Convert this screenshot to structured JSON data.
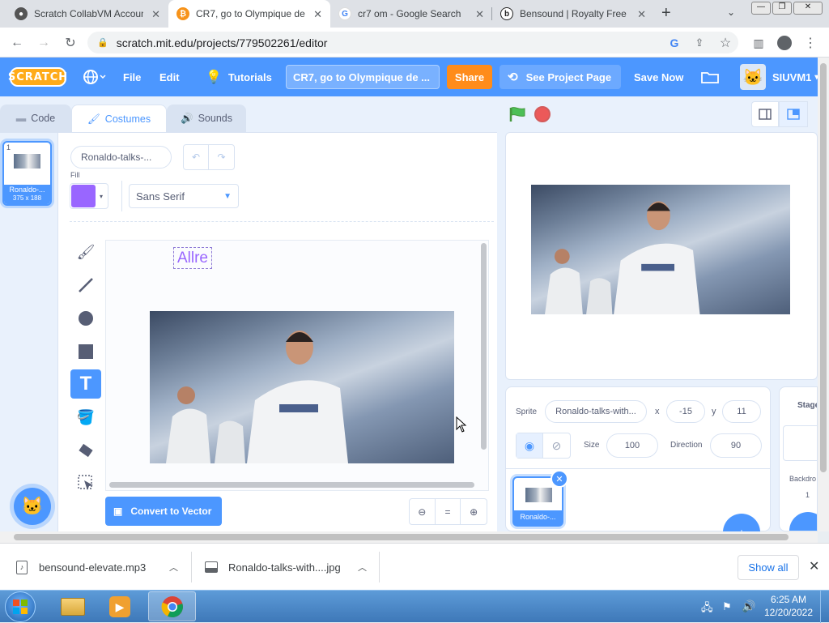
{
  "browser": {
    "tabs": [
      {
        "title": "Scratch CollabVM Accoun",
        "icon": "github-icon"
      },
      {
        "title": "CR7, go to Olympique de",
        "icon": "bitcoin-icon"
      },
      {
        "title": "cr7 om - Google Search",
        "icon": "google-icon"
      },
      {
        "title": "Bensound | Royalty Free M",
        "icon": "bensound-icon"
      }
    ],
    "url": "scratch.mit.edu/projects/779502261/editor"
  },
  "menubar": {
    "file": "File",
    "edit": "Edit",
    "tutorials": "Tutorials",
    "project_title": "CR7, go to Olympique de ...",
    "share": "Share",
    "see_project": "See Project Page",
    "save_now": "Save Now",
    "username": "SIUVM1"
  },
  "editor_tabs": {
    "code": "Code",
    "costumes": "Costumes",
    "sounds": "Sounds"
  },
  "costume_list": [
    {
      "number": "1",
      "name": "Ronaldo-...",
      "size": "375 x 188"
    }
  ],
  "paint": {
    "costume_name": "Ronaldo-talks-...",
    "fill_label": "Fill",
    "fill_color": "#9966ff",
    "font": "Sans Serif",
    "canvas_text": "Allre",
    "convert_button": "Convert to Vector",
    "zoom_equal": "="
  },
  "sprite_info": {
    "sprite_label": "Sprite",
    "sprite_name": "Ronaldo-talks-with...",
    "x_label": "x",
    "x": "-15",
    "y_label": "y",
    "y": "11",
    "size_label": "Size",
    "size": "100",
    "direction_label": "Direction",
    "direction": "90",
    "sprite_tile_name": "Ronaldo-..."
  },
  "stage_panel": {
    "title": "Stage",
    "backdrops_label": "Backdro",
    "backdrops_count": "1"
  },
  "downloads": {
    "items": [
      {
        "name": "bensound-elevate.mp3",
        "icon": "audio-file-icon"
      },
      {
        "name": "Ronaldo-talks-with....jpg",
        "icon": "image-file-icon"
      }
    ],
    "show_all": "Show all"
  },
  "taskbar": {
    "time": "6:25 AM",
    "date": "12/20/2022"
  },
  "colors": {
    "scratch_blue": "#4c97ff",
    "share_orange": "#ff8c1a",
    "fill_purple": "#9966ff",
    "active_tool": "#4c97ff"
  }
}
